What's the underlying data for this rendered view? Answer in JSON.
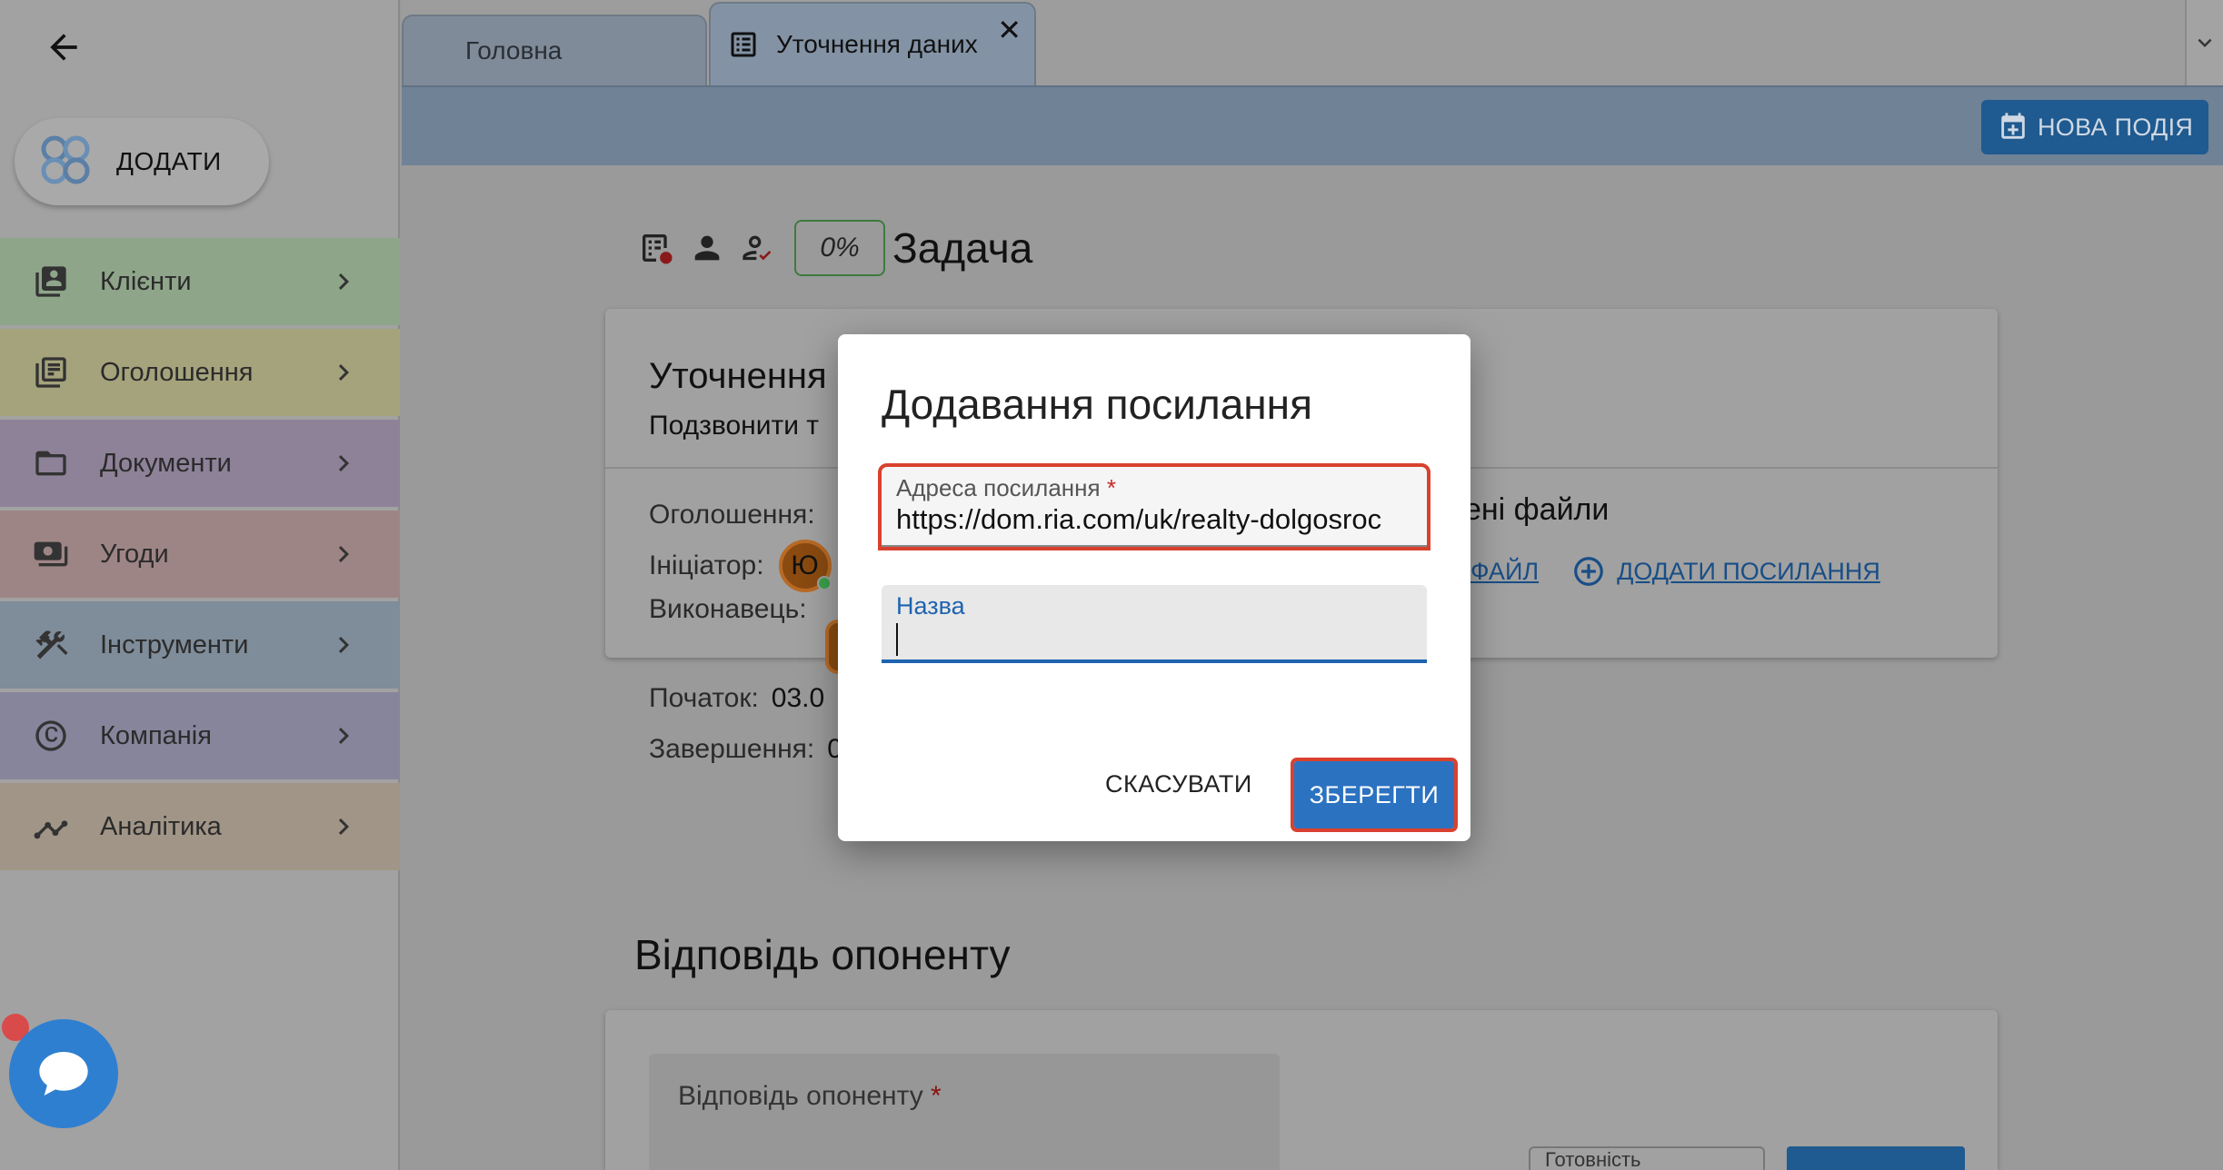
{
  "sidebar": {
    "add_label": "ДОДАТИ",
    "items": [
      {
        "label": "Клієнти",
        "icon": "clients-icon",
        "color": "#8fa58a"
      },
      {
        "label": "Оголошення",
        "icon": "listings-icon",
        "color": "#a4a37c"
      },
      {
        "label": "Документи",
        "icon": "folder-icon",
        "color": "#8e8299"
      },
      {
        "label": "Угоди",
        "icon": "deals-icon",
        "color": "#9e8585"
      },
      {
        "label": "Інструменти",
        "icon": "tools-icon",
        "color": "#7f8c99"
      },
      {
        "label": "Компанія",
        "icon": "copyright-icon",
        "color": "#87859c"
      },
      {
        "label": "Аналітика",
        "icon": "analytics-icon",
        "color": "#a19587"
      }
    ]
  },
  "tabs": {
    "home_label": "Головна",
    "active_label": "Уточнення даних",
    "close_glyph": "✕"
  },
  "toolbar": {
    "new_event_label": "НОВА ПОДІЯ"
  },
  "task": {
    "progress": "0%",
    "title": "Задача"
  },
  "card": {
    "title": "Уточнення",
    "subtitle": "Подзвонити т",
    "listing_label": "Оголошення:",
    "initiator_label": "Ініціатор:",
    "initiator_initial": "Ю",
    "executor_label": "Виконавець:",
    "start_label": "Початок:",
    "start_value": "03.0",
    "end_label": "Завершення:",
    "end_value": "0",
    "attached_title": "ені файли",
    "file_link": "ФАЙЛ",
    "add_link": "ДОДАТИ ПОСИЛАННЯ"
  },
  "response": {
    "section_title": "Відповідь опоненту",
    "field_label": "Відповідь опоненту",
    "required_mark": "*",
    "mini_field": "Готовність"
  },
  "modal": {
    "title": "Додавання посилання",
    "url_label": "Адреса посилання",
    "url_required": "*",
    "url_value": "https://dom.ria.com/uk/realty-dolgosroc",
    "name_label": "Назва",
    "cancel_label": "СКАСУВАТИ",
    "save_label": "ЗБЕРЕГТИ"
  },
  "colors": {
    "accent": "#2b72c0",
    "highlight": "#d9412e",
    "chat": "#2f7fd0"
  }
}
